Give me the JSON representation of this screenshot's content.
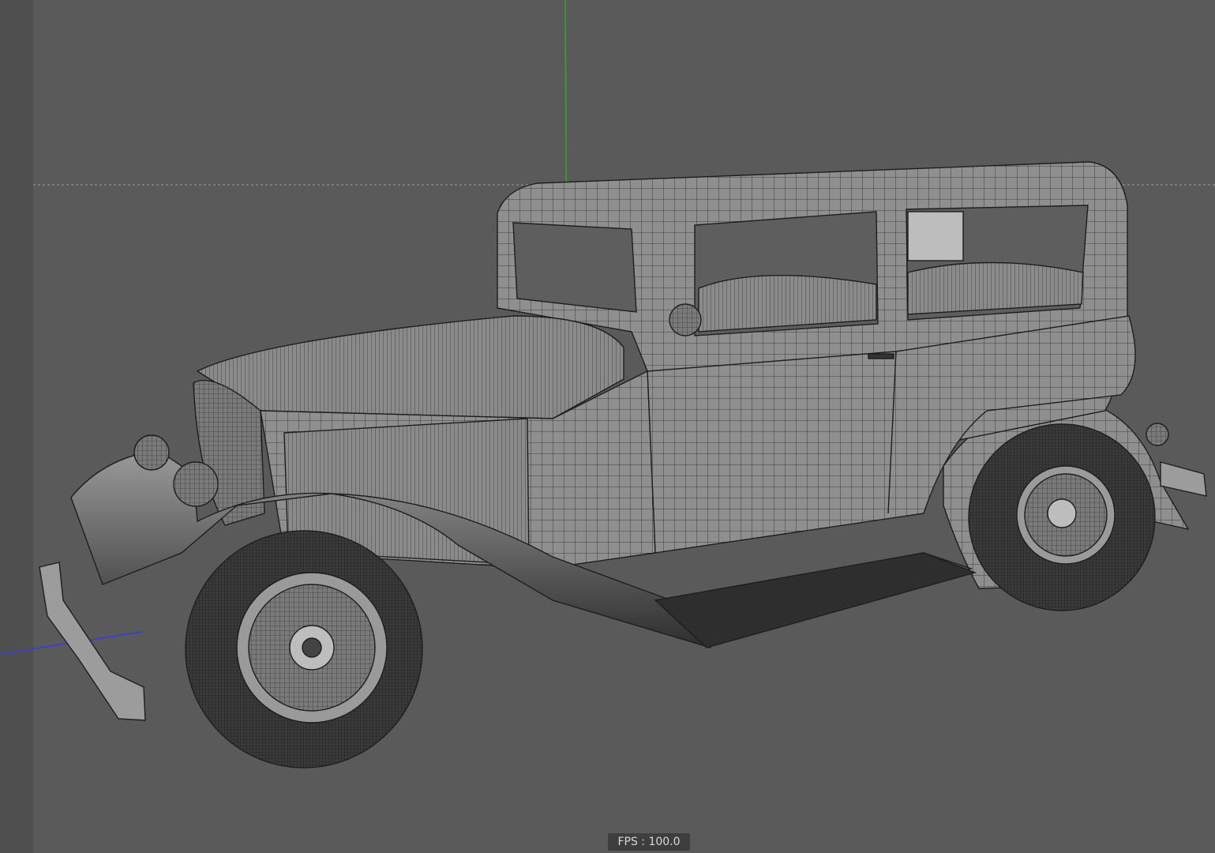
{
  "viewport": {
    "fps_label": "FPS : 100.0"
  },
  "colors": {
    "background": "#595959",
    "y_axis": "#2fa52f",
    "z_axis": "#3a3ae0",
    "grid_line": "#9a9a9a",
    "mesh_fill": "#8e8e8e",
    "wire": "#1e1e1e"
  },
  "icons": {
    "y_axis": "y-axis-line",
    "z_axis": "z-axis-line"
  }
}
